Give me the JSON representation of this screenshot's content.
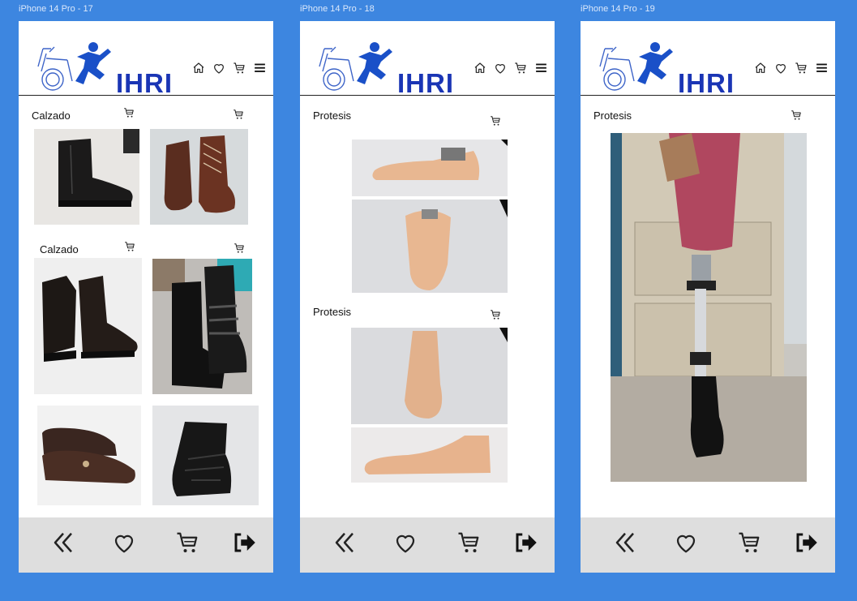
{
  "frames": [
    {
      "label": "iPhone 14 Pro - 17",
      "brand": "IHRI",
      "sections": [
        {
          "title": "Calzado"
        },
        {
          "title": "Calzado"
        }
      ],
      "products": [
        "black-ankle-boot",
        "brown-lace-up-boot",
        "black-zip-boot",
        "black-strap-boot",
        "brown-mary-jane-shoe",
        "black-orthopedic-bootie"
      ]
    },
    {
      "label": "iPhone 14 Pro - 18",
      "brand": "IHRI",
      "sections": [
        {
          "title": "Protesis"
        },
        {
          "title": "Protesis"
        }
      ],
      "products": [
        "prosthetic-foot-side",
        "prosthetic-foot-top",
        "prosthetic-foot-top-2",
        "prosthetic-foot-side-2"
      ]
    },
    {
      "label": "iPhone 14 Pro - 19",
      "brand": "IHRI",
      "sections": [
        {
          "title": "Protesis"
        }
      ],
      "products": [
        "leg-prosthesis-with-shoe"
      ]
    }
  ],
  "icons": {
    "header": [
      "home-icon",
      "heart-icon",
      "cart-icon",
      "menu-icon"
    ],
    "bottom": [
      "double-chevron-left-icon",
      "heart-icon",
      "cart-icon",
      "logout-icon"
    ]
  },
  "colors": {
    "background": "#3d86e0",
    "brand_blue": "#1a35b5",
    "bottom_bar": "#dedede"
  }
}
